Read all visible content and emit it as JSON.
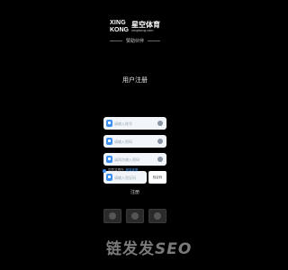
{
  "brand": {
    "name_en_line1": "XING",
    "name_en_line2": "KONG",
    "name_cn": "星空体育",
    "domain": "xingkong.com"
  },
  "sponsor_text": "赞助伙伴",
  "form": {
    "title": "用户注册",
    "fields": [
      {
        "placeholder": "请输入账号"
      },
      {
        "placeholder": "请输入密码"
      },
      {
        "placeholder": "请再次输入密码"
      },
      {
        "placeholder": "请输入验证码"
      }
    ],
    "captcha_alt": "验证码",
    "agree_label": "同意并遵守",
    "agree_link": "服务政策",
    "submit_label": "注册"
  },
  "watermark": {
    "cn": "链发发",
    "latin": "SEO"
  }
}
